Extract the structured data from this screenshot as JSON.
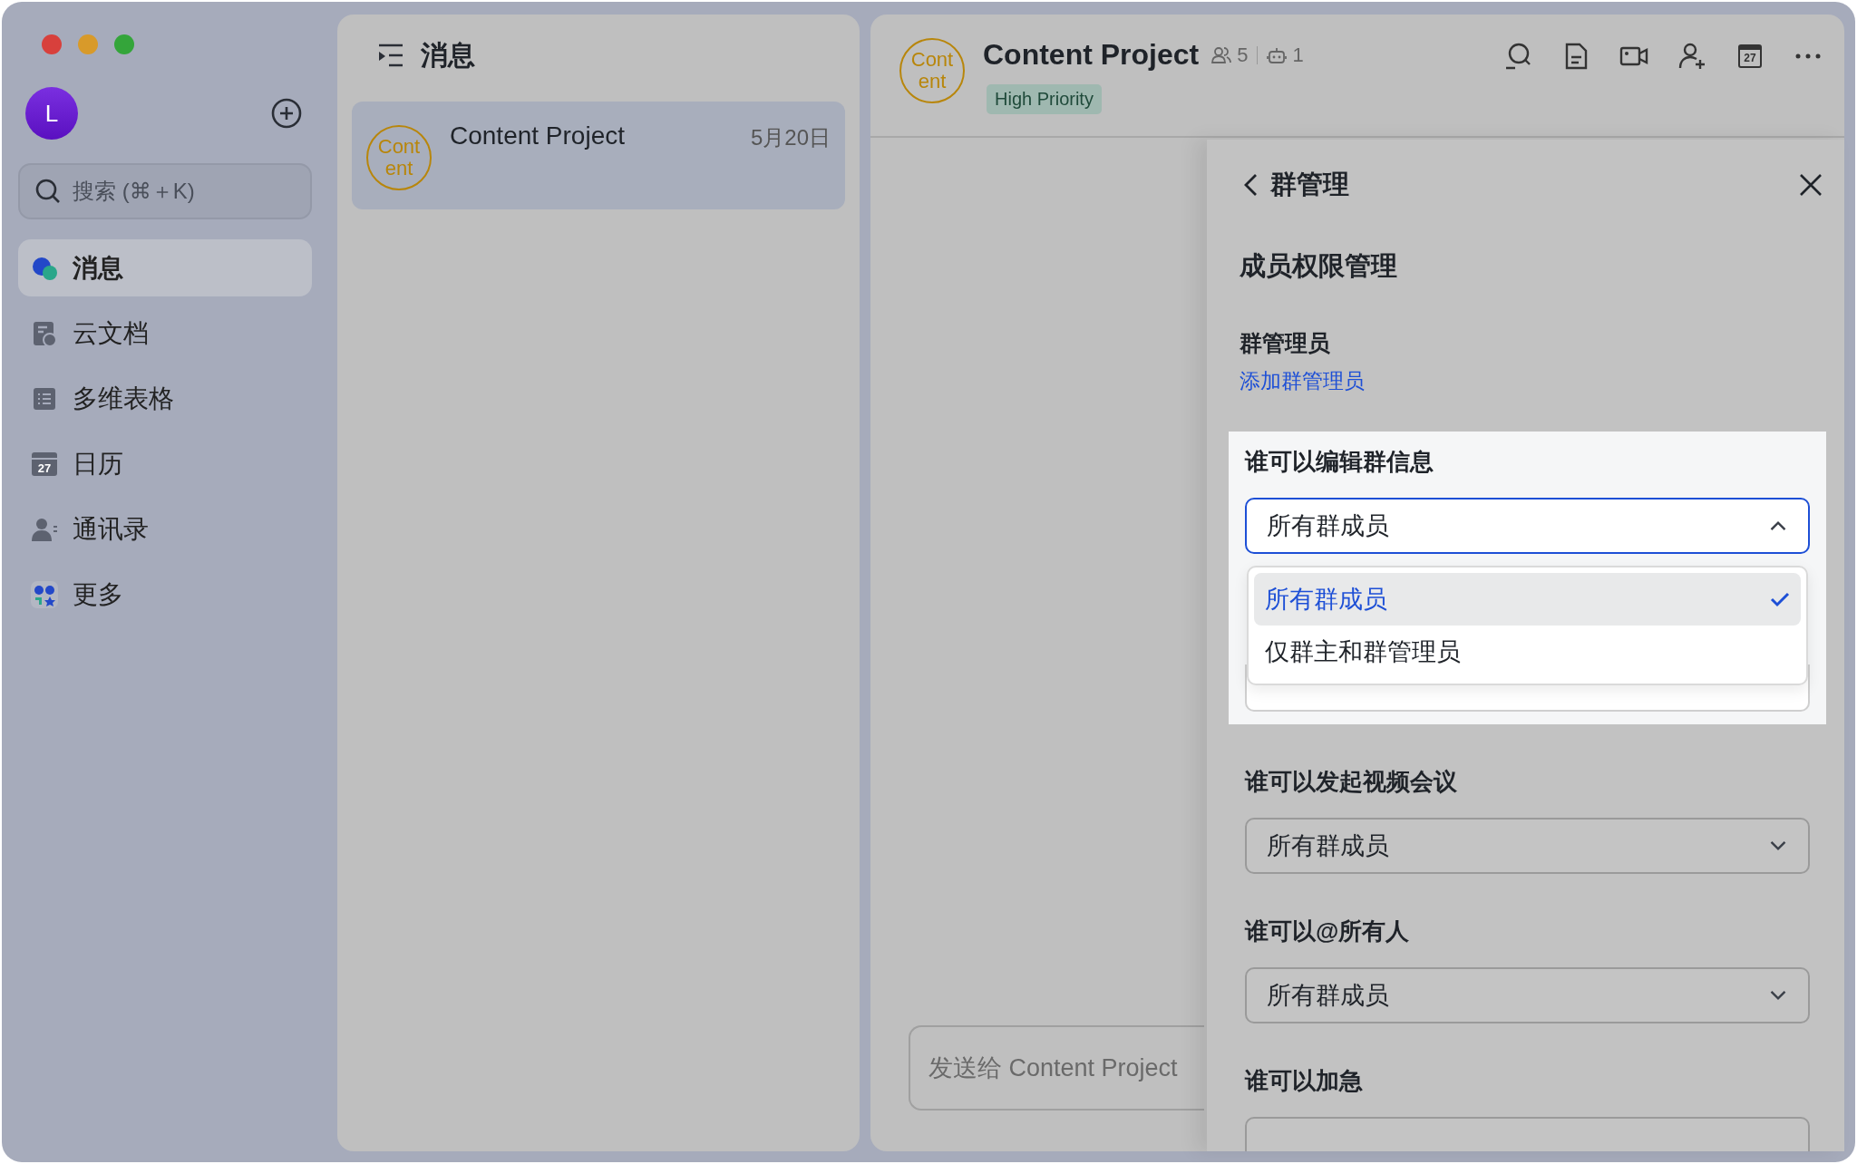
{
  "sidebar": {
    "avatar": "L",
    "search": {
      "placeholder": "搜索 (⌘＋K)"
    },
    "items": [
      {
        "kind": "messages",
        "label": "消息",
        "selected": true
      },
      {
        "kind": "docs",
        "label": "云文档",
        "selected": false
      },
      {
        "kind": "base",
        "label": "多维表格",
        "selected": false
      },
      {
        "kind": "calendar",
        "label": "日历",
        "icon_label": "27",
        "selected": false
      },
      {
        "kind": "contacts",
        "label": "通讯录",
        "selected": false
      },
      {
        "kind": "more",
        "label": "更多",
        "selected": false
      }
    ]
  },
  "chat_list": {
    "title": "消息",
    "conversations": [
      {
        "avatar_lines": [
          "Cont",
          "ent"
        ],
        "name": "Content Project",
        "date": "5月20日",
        "selected": true
      }
    ]
  },
  "chat": {
    "avatar_lines": [
      "Cont",
      "ent"
    ],
    "title": "Content Project",
    "members": "5",
    "bots": "1",
    "tag": "High Priority",
    "toolbar": [
      {
        "kind": "search"
      },
      {
        "kind": "doc"
      },
      {
        "kind": "video"
      },
      {
        "kind": "add-member"
      },
      {
        "kind": "calendar",
        "icon_label": "27"
      },
      {
        "kind": "more"
      }
    ],
    "input": {
      "placeholder": "发送给 Content Project"
    }
  },
  "panel": {
    "title": "群管理",
    "section": "成员权限管理",
    "admins_label": "群管理员",
    "add_admin_link": "添加群管理员",
    "settings": [
      {
        "label": "谁可以编辑群信息",
        "value": "所有群成员",
        "highlighted": true,
        "expanded": true,
        "options": [
          {
            "label": "所有群成员",
            "selected": true
          },
          {
            "label": "仅群主和群管理员",
            "selected": false
          }
        ]
      },
      {
        "label": "谁可以发起视频会议",
        "value": "所有群成员",
        "highlighted": false,
        "expanded": false
      },
      {
        "label": "谁可以@所有人",
        "value": "所有群成员",
        "highlighted": false,
        "expanded": false
      },
      {
        "label": "谁可以加急",
        "highlighted": false,
        "expanded": false
      }
    ]
  }
}
